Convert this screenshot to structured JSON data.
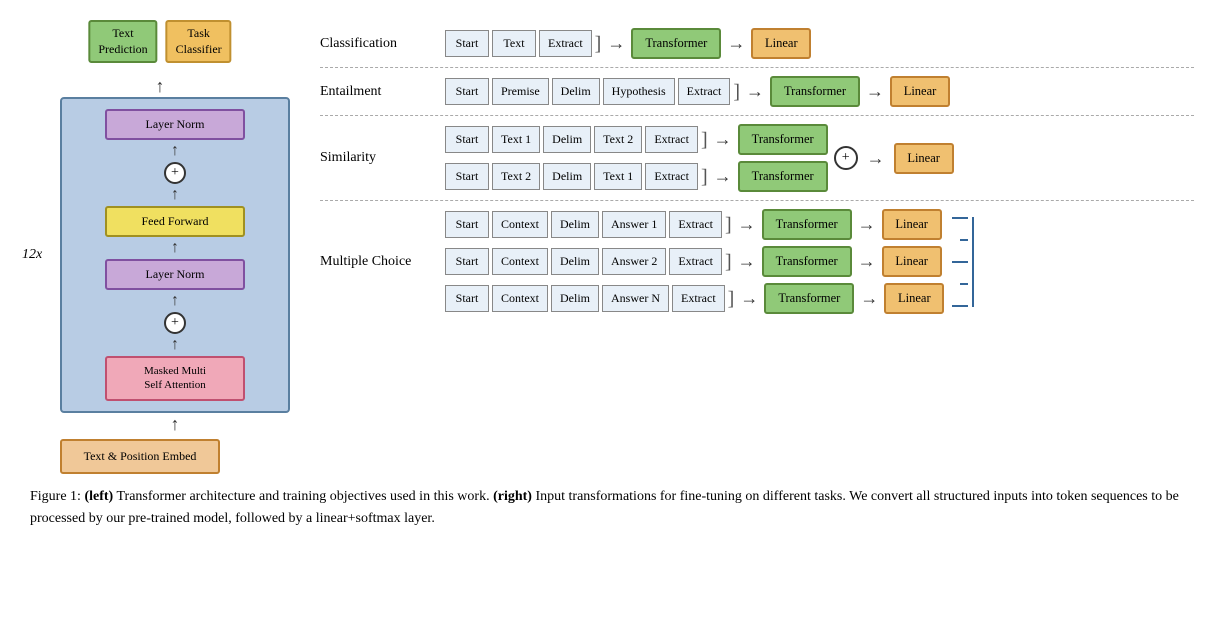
{
  "left": {
    "output_boxes": [
      {
        "label": "Text\nPrediction",
        "color": "green"
      },
      {
        "label": "Task\nClassifier",
        "color": "orange"
      }
    ],
    "repeat_label": "12x",
    "blocks": [
      {
        "type": "layernorm",
        "label": "Layer Norm"
      },
      {
        "type": "plus"
      },
      {
        "type": "feedforward",
        "label": "Feed Forward"
      },
      {
        "type": "layernorm",
        "label": "Layer Norm"
      },
      {
        "type": "plus"
      },
      {
        "type": "attention",
        "label": "Masked Multi\nSelf Attention"
      }
    ],
    "embed_label": "Text & Position Embed"
  },
  "tasks": [
    {
      "name": "Classification",
      "rows": [
        {
          "tokens": [
            "Start",
            "Text",
            "Extract"
          ],
          "bracket": true,
          "transformer": "Transformer",
          "linear": "Linear"
        }
      ]
    },
    {
      "name": "Entailment",
      "rows": [
        {
          "tokens": [
            "Start",
            "Premise",
            "Delim",
            "Hypothesis",
            "Extract"
          ],
          "bracket": true,
          "transformer": "Transformer",
          "linear": "Linear"
        }
      ]
    },
    {
      "name": "Similarity",
      "rows": [
        {
          "tokens": [
            "Start",
            "Text 1",
            "Delim",
            "Text 2",
            "Extract"
          ],
          "bracket": true,
          "transformer": "Transformer"
        },
        {
          "tokens": [
            "Start",
            "Text 2",
            "Delim",
            "Text 1",
            "Extract"
          ],
          "bracket": true,
          "transformer": "Transformer"
        }
      ],
      "combine": "+",
      "linear": "Linear"
    },
    {
      "name": "Multiple Choice",
      "rows": [
        {
          "tokens": [
            "Start",
            "Context",
            "Delim",
            "Answer 1",
            "Extract"
          ],
          "bracket": true,
          "transformer": "Transformer",
          "linear": "Linear"
        },
        {
          "tokens": [
            "Start",
            "Context",
            "Delim",
            "Answer 2",
            "Extract"
          ],
          "bracket": true,
          "transformer": "Transformer",
          "linear": "Linear"
        },
        {
          "tokens": [
            "Start",
            "Context",
            "Delim",
            "Answer N",
            "Extract"
          ],
          "bracket": true,
          "transformer": "Transformer",
          "linear": "Linear"
        }
      ]
    }
  ],
  "caption": {
    "figure_num": "Figure 1:",
    "left_bold": "(left)",
    "left_text": " Transformer architecture and training objectives used in this work. ",
    "right_bold": "(right)",
    "right_text": " Input transformations for fine-tuning on different tasks.  We convert all structured inputs into token sequences to be processed by our pre-trained model, followed by a linear+softmax layer."
  }
}
